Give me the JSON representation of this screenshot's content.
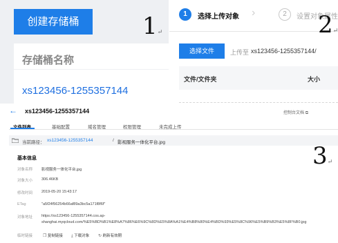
{
  "panel1": {
    "create_bucket_button": "创建存储桶",
    "bucket_name_label": "存储桶名称",
    "bucket_name_value": "xs123456-1255357144",
    "marker": "1"
  },
  "panel2": {
    "step1_number": "1",
    "step1_label": "选择上传对象",
    "step2_number": "2",
    "step2_label": "设置对象属性",
    "choose_file_button": "选择文件",
    "upload_to_label": "上传至",
    "upload_to_path": "xs123456-1255357144/",
    "columns": [
      "文件/文件夹",
      "大小"
    ],
    "marker": "2"
  },
  "panel3": {
    "back_icon": "arrow-left-icon",
    "bucket_title": "xs123456-1255357144",
    "doc_link": "控制台文档",
    "tabs": [
      "文件列表",
      "基础配置",
      "域名管理",
      "权限管理",
      "未完成上传"
    ],
    "active_tab": "文件列表",
    "path_label": "当前路径：",
    "path_link": "xs123456-1255357144",
    "path_separator": "/",
    "path_file": "影视服务一体化平台.jpg",
    "section_title": "基本信息",
    "details": {
      "name_key": "对象名称",
      "name_value": "影视服务一体化平台.jpg",
      "size_key": "对象大小",
      "size_value": "306.46KB",
      "modified_key": "修改时间",
      "modified_value": "2019-05-20 15:43:17",
      "etag_key": "ETag",
      "etag_value": "\"a5f24f56254b66af89a3bc5a171f8f6f\"",
      "address_key": "对象地址",
      "address_line1": "https://xs123456-1255357144.cos.ap-",
      "address_line2": "shanghai.myqcloud.com/%E5%BD%B1%E8%A7%86%E6%9C%8D%E5%8A%A1%E4%B8%80%E4%BD%93%E5%8C%96%E5%B9%B3%E5%8F%B0.jpg",
      "temp_link_key": "临时链接",
      "actions": [
        "复制链接",
        "下载对象",
        "刷新有效期"
      ]
    },
    "marker": "3"
  },
  "colors": {
    "primary_blue": "#1e7ee8",
    "link_blue": "#1e6fe0",
    "panel_gray": "#eef0f3"
  }
}
